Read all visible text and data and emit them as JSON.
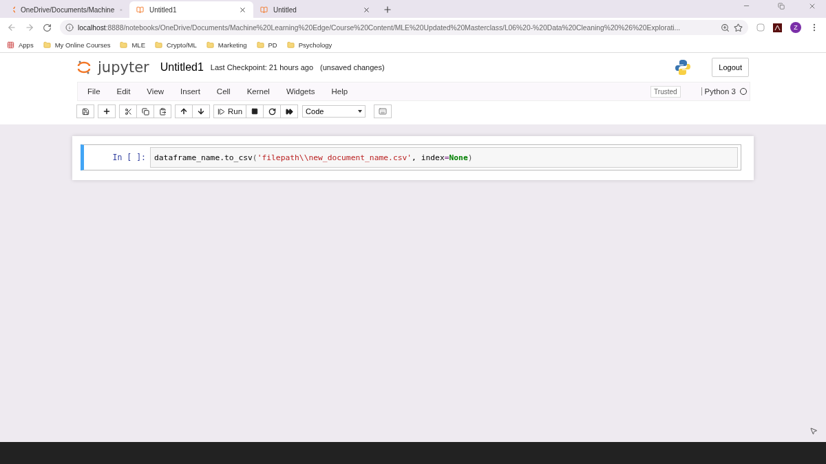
{
  "browser_tabs": [
    {
      "title": "OneDrive/Documents/Machine",
      "kind": "jupyter",
      "selected": false
    },
    {
      "title": "Untitled1",
      "kind": "notebook",
      "selected": true
    },
    {
      "title": "Untitled",
      "kind": "notebook",
      "selected": false
    }
  ],
  "address": {
    "host": "localhost",
    "path": ":8888/notebooks/OneDrive/Documents/Machine%20Learning%20Edge/Course%20Content/MLE%20Updated%20Masterclass/L06%20-%20Data%20Cleaning%20%26%20Explorati..."
  },
  "profile": "Z",
  "bookmarks": [
    {
      "label": "Apps",
      "kind": "apps"
    },
    {
      "label": "My Online Courses",
      "kind": "folder"
    },
    {
      "label": "MLE",
      "kind": "folder"
    },
    {
      "label": "Crypto/ML",
      "kind": "folder"
    },
    {
      "label": "Marketing",
      "kind": "folder"
    },
    {
      "label": "PD",
      "kind": "folder"
    },
    {
      "label": "Psychology",
      "kind": "folder"
    }
  ],
  "header": {
    "logo_text": "jupyter",
    "notebook_name": "Untitled1",
    "checkpoint": "Last Checkpoint: 21 hours ago",
    "autosave": "(unsaved changes)",
    "logout": "Logout"
  },
  "menu": [
    "File",
    "Edit",
    "View",
    "Insert",
    "Cell",
    "Kernel",
    "Widgets",
    "Help"
  ],
  "trusted": "Trusted",
  "kernel": {
    "name": "Python 3",
    "busy": false
  },
  "run_label": "Run",
  "cell_type": "Code",
  "cells": [
    {
      "prompt": "In [ ]:",
      "selected": true,
      "code": [
        {
          "text": "dataframe_name.to_csv",
          "kind": "plain"
        },
        {
          "text": "(",
          "kind": "paren"
        },
        {
          "text": "'filepath\\\\new_document_name.csv'",
          "kind": "string"
        },
        {
          "text": ", index",
          "kind": "plain"
        },
        {
          "text": "=",
          "kind": "operator"
        },
        {
          "text": "None",
          "kind": "keyword"
        },
        {
          "text": ")",
          "kind": "paren"
        }
      ]
    }
  ]
}
